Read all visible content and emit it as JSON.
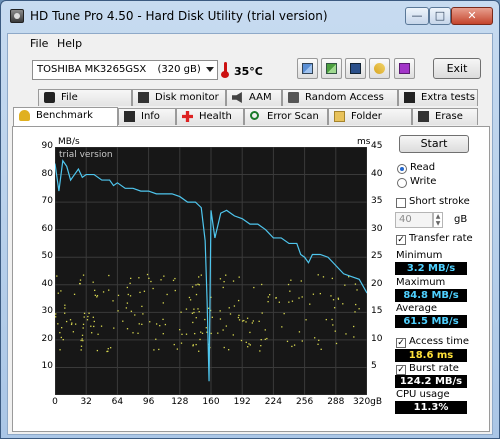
{
  "window": {
    "title": "HD Tune Pro 4.50 - Hard Disk Utility (trial version)"
  },
  "menu": {
    "file": "File",
    "help": "Help"
  },
  "toolbar": {
    "drive": "TOSHIBA MK3265GSX",
    "drive_size": "(320 gB)",
    "temperature": "35°C",
    "exit": "Exit"
  },
  "tabs_top": [
    "File Benchmark",
    "Disk monitor",
    "AAM",
    "Random Access",
    "Extra tests"
  ],
  "tabs_bottom": [
    "Benchmark",
    "Info",
    "Health",
    "Error Scan",
    "Folder Usage",
    "Erase"
  ],
  "side": {
    "start": "Start",
    "read": "Read",
    "write": "Write",
    "short_stroke": "Short stroke",
    "stroke_value": "40",
    "stroke_unit": "gB",
    "transfer_rate": "Transfer rate",
    "minimum_label": "Minimum",
    "minimum_value": "3.2 MB/s",
    "maximum_label": "Maximum",
    "maximum_value": "84.8 MB/s",
    "average_label": "Average",
    "average_value": "61.5 MB/s",
    "access_time_label": "Access time",
    "access_time_value": "18.6 ms",
    "burst_rate_label": "Burst rate",
    "burst_rate_value": "124.2 MB/s",
    "cpu_usage_label": "CPU usage",
    "cpu_usage_value": "11.3%"
  },
  "chart_data": {
    "type": "line",
    "watermark": "trial version",
    "ylabel_left": "MB/s",
    "ylabel_right": "ms",
    "left_ticks": [
      10,
      20,
      30,
      40,
      50,
      60,
      70,
      80,
      90
    ],
    "right_ticks": [
      5,
      10,
      15,
      20,
      25,
      30,
      35,
      40,
      45
    ],
    "x_ticks": [
      "0",
      "32",
      "64",
      "96",
      "128",
      "160",
      "192",
      "224",
      "256",
      "288",
      "320gB"
    ],
    "xlim": [
      0,
      320
    ],
    "ylim_left": [
      0,
      90
    ],
    "ylim_right": [
      0,
      45
    ],
    "series": [
      {
        "name": "Transfer rate",
        "color": "#4fc6ee",
        "x": [
          0,
          4,
          8,
          12,
          16,
          20,
          24,
          28,
          32,
          40,
          48,
          56,
          60,
          64,
          72,
          80,
          88,
          96,
          104,
          112,
          120,
          128,
          136,
          144,
          150,
          154,
          156,
          158,
          160,
          164,
          170,
          176,
          184,
          192,
          200,
          208,
          216,
          224,
          232,
          240,
          248,
          252,
          256,
          260,
          264,
          272,
          280,
          288,
          296,
          304,
          312,
          320
        ],
        "y": [
          84,
          74,
          85,
          83,
          78,
          80,
          82,
          79,
          80,
          80,
          78,
          78,
          76,
          77,
          75,
          75,
          74,
          74,
          73,
          73,
          73,
          72,
          70,
          70,
          68,
          56,
          34,
          5,
          67,
          57,
          66,
          67,
          65,
          64,
          62,
          62,
          60,
          57,
          57,
          55,
          55,
          51,
          50,
          48,
          51,
          51,
          50,
          47,
          44,
          43,
          42,
          37
        ]
      }
    ],
    "scatter": {
      "name": "Access time",
      "color": "#d8d850",
      "range_ms": [
        8,
        22
      ]
    },
    "grid": true
  }
}
